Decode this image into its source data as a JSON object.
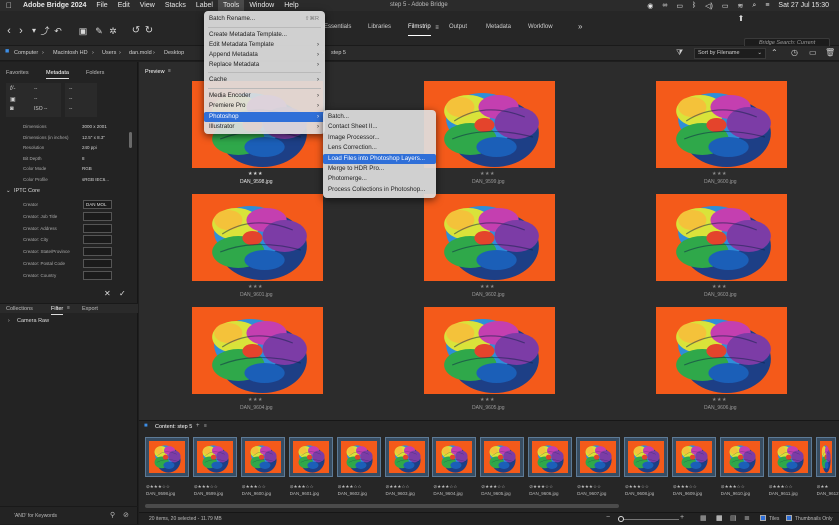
{
  "menubar": {
    "app": "Adobe Bridge 2024",
    "items": [
      "File",
      "Edit",
      "View",
      "Stacks",
      "Label",
      "Tools",
      "Window",
      "Help"
    ],
    "window_title": "step 5 - Adobe Bridge",
    "clock": "Sat 27 Jul  15:30"
  },
  "toolbar": {
    "workspace_tabs": [
      "Essentials",
      "Libraries",
      "Filmstrip",
      "Output",
      "Metadata",
      "Workflow"
    ],
    "active_workspace": "Filmstrip",
    "more": "»",
    "search_placeholder": "Bridge Search: Current"
  },
  "pathbar": {
    "crumbs": [
      "Computer",
      "Macintosh HD",
      "Users",
      "dan.mold",
      "Desktop",
      "step 5"
    ],
    "sort_label": "Sort by Filename"
  },
  "left_panel": {
    "tabs": [
      "Favorites",
      "Metadata",
      "Folders"
    ],
    "active_tab": "Metadata",
    "placard": {
      "fstop": "f/-",
      "dash1": "--",
      "dash2": "--",
      "iso": "ISO --",
      "dash3": "--",
      "dash4": "--",
      "dash5": "--"
    },
    "file_properties": [
      {
        "label": "Dimensions",
        "value": "3000 x 2001"
      },
      {
        "label": "Dimensions (in inches)",
        "value": "12.5\" x 8.3\""
      },
      {
        "label": "Resolution",
        "value": "240 ppi"
      },
      {
        "label": "Bit Depth",
        "value": "8"
      },
      {
        "label": "Color Mode",
        "value": "RGB"
      },
      {
        "label": "Color Profile",
        "value": "sRGB IEC6..."
      }
    ],
    "iptc_title": "IPTC Core",
    "iptc_fields": [
      {
        "label": "Creator",
        "value": "DAN MOL"
      },
      {
        "label": "Creator: Job Title",
        "value": ""
      },
      {
        "label": "Creator: Address",
        "value": ""
      },
      {
        "label": "Creator: City",
        "value": ""
      },
      {
        "label": "Creator: State/Province",
        "value": ""
      },
      {
        "label": "Creator: Postal Code",
        "value": ""
      },
      {
        "label": "Creator: Country",
        "value": ""
      }
    ],
    "lower_tabs": [
      "Collections",
      "Filter",
      "Export"
    ],
    "lower_active": "Filter",
    "filter_item": "Camera Raw",
    "keywords_label": "'AND' for Keywords"
  },
  "preview": {
    "title": "Preview",
    "tiles": [
      {
        "name": "DAN_9598.jpg",
        "stars": "★★★",
        "rated": true,
        "selected": true
      },
      {
        "name": "DAN_9599.jpg",
        "stars": "★★★",
        "rated": false,
        "selected": false
      },
      {
        "name": "DAN_9600.jpg",
        "stars": "★★★",
        "rated": false,
        "selected": false
      },
      {
        "name": "DAN_9601.jpg",
        "stars": "★★★",
        "rated": false,
        "selected": false
      },
      {
        "name": "DAN_9602.jpg",
        "stars": "★★★",
        "rated": false,
        "selected": false
      },
      {
        "name": "DAN_9603.jpg",
        "stars": "★★★",
        "rated": false,
        "selected": false
      },
      {
        "name": "DAN_9604.jpg",
        "stars": "★★★",
        "rated": false,
        "selected": false
      },
      {
        "name": "DAN_9605.jpg",
        "stars": "★★★",
        "rated": false,
        "selected": false
      },
      {
        "name": "DAN_9606.jpg",
        "stars": "★★★",
        "rated": false,
        "selected": false
      }
    ]
  },
  "content": {
    "title": "Content: step 5",
    "items": [
      {
        "name": "DAN_9598.jpg",
        "stars": "⊘★★★☆☆"
      },
      {
        "name": "DAN_9599.jpg",
        "stars": "⊘★★★☆☆"
      },
      {
        "name": "DAN_9600.jpg",
        "stars": "⊘★★★☆☆"
      },
      {
        "name": "DAN_9601.jpg",
        "stars": "⊘★★★☆☆"
      },
      {
        "name": "DAN_9602.jpg",
        "stars": "⊘★★★☆☆"
      },
      {
        "name": "DAN_9603.jpg",
        "stars": "⊘★★★☆☆"
      },
      {
        "name": "DAN_9604.jpg",
        "stars": "⊘★★★☆☆"
      },
      {
        "name": "DAN_9605.jpg",
        "stars": "⊘★★★☆☆"
      },
      {
        "name": "DAN_9606.jpg",
        "stars": "⊘★★★☆☆"
      },
      {
        "name": "DAN_9607.jpg",
        "stars": "⊘★★★☆☆"
      },
      {
        "name": "DAN_9608.jpg",
        "stars": "⊘★★★☆☆"
      },
      {
        "name": "DAN_9609.jpg",
        "stars": "⊘★★★☆☆"
      },
      {
        "name": "DAN_9610.jpg",
        "stars": "⊘★★★☆☆"
      },
      {
        "name": "DAN_9611.jpg",
        "stars": "⊘★★★☆☆"
      },
      {
        "name": "DAN_9612.jpg",
        "stars": "⊘★★"
      }
    ]
  },
  "status": {
    "summary": "20 items, 20 selected - 11.79 MB",
    "tiles_label": "Tiles",
    "thumbs_only_label": "Thumbnails Only"
  },
  "tools_menu": {
    "items": [
      {
        "label": "Batch Rename...",
        "shortcut": "⇧⌘R",
        "arrow": false
      },
      {
        "label": "Create Metadata Template...",
        "shortcut": "",
        "arrow": false
      },
      {
        "label": "Edit Metadata Template",
        "shortcut": "",
        "arrow": true
      },
      {
        "label": "Append Metadata",
        "shortcut": "",
        "arrow": true
      },
      {
        "label": "Replace Metadata",
        "shortcut": "",
        "arrow": true
      },
      {
        "label": "Cache",
        "shortcut": "",
        "arrow": true
      },
      {
        "label": "Media Encoder",
        "shortcut": "",
        "arrow": true
      },
      {
        "label": "Premiere Pro",
        "shortcut": "",
        "arrow": true
      },
      {
        "label": "Photoshop",
        "shortcut": "",
        "arrow": true
      },
      {
        "label": "Illustrator",
        "shortcut": "",
        "arrow": true
      }
    ],
    "highlighted": "Photoshop"
  },
  "photoshop_submenu": {
    "items": [
      "Batch...",
      "Contact Sheet II...",
      "Image Processor...",
      "Lens Correction...",
      "Load Files into Photoshop Layers...",
      "Merge to HDR Pro...",
      "Photomerge...",
      "Process Collections in Photoshop..."
    ],
    "highlighted": "Load Files into Photoshop Layers..."
  },
  "colors": {
    "accent": "#2f6fd8",
    "photo_bg": "#f45a1a"
  }
}
